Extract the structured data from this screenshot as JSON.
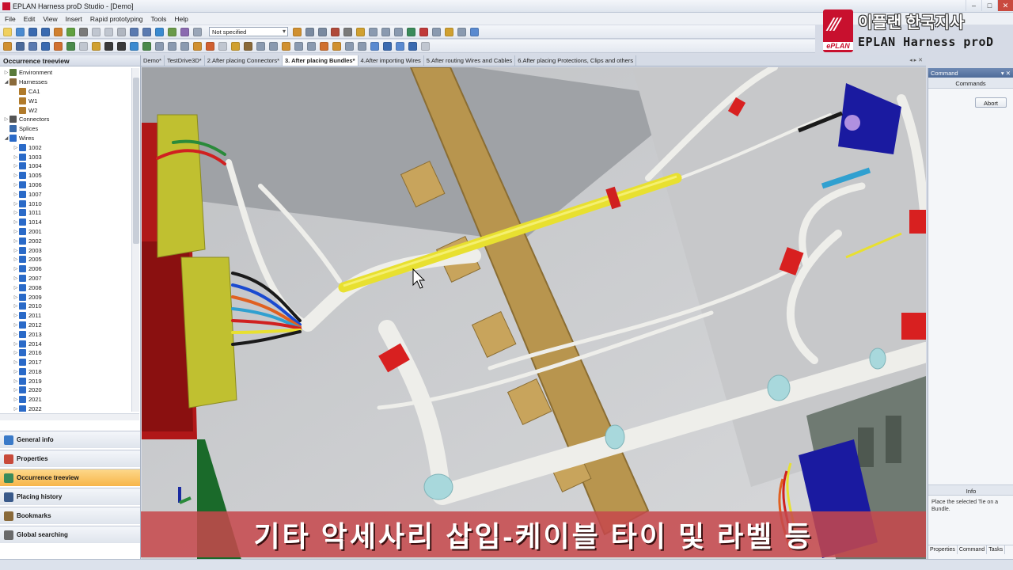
{
  "window": {
    "title": "EPLAN Harness proD Studio - [Demo]"
  },
  "menu": {
    "items": [
      "File",
      "Edit",
      "View",
      "Insert",
      "Rapid prototyping",
      "Tools",
      "Help"
    ]
  },
  "toolbar": {
    "filter_value": "Not specified"
  },
  "logo": {
    "korean_text": "이플랜 한국지사",
    "brand_text": "EPLAN Harness proD",
    "mark_text": "ePLAN"
  },
  "left_panel": {
    "title": "Occurrence treeview",
    "tree": [
      {
        "label": "Environment",
        "level": 0,
        "icon": "environment-icon",
        "color": "#5a7a3a",
        "expand": "▷"
      },
      {
        "label": "Harnesses",
        "level": 0,
        "icon": "harness-icon",
        "color": "#8a6a3a",
        "expand": "◢"
      },
      {
        "label": "CA1",
        "level": 1,
        "icon": "harness-icon",
        "color": "#b07a2a",
        "expand": ""
      },
      {
        "label": "W1",
        "level": 1,
        "icon": "harness-icon",
        "color": "#b07a2a",
        "expand": ""
      },
      {
        "label": "W2",
        "level": 1,
        "icon": "harness-icon",
        "color": "#b07a2a",
        "expand": ""
      },
      {
        "label": "Connectors",
        "level": 0,
        "icon": "connector-icon",
        "color": "#555555",
        "expand": "▷"
      },
      {
        "label": "Splices",
        "level": 0,
        "icon": "splice-icon",
        "color": "#3a6aaa",
        "expand": ""
      },
      {
        "label": "Wires",
        "level": 0,
        "icon": "wire-icon",
        "color": "#2a6ac8",
        "expand": "◢"
      },
      {
        "label": "1002",
        "level": 1,
        "icon": "wire-icon",
        "color": "#2a6ac8",
        "expand": "▷"
      },
      {
        "label": "1003",
        "level": 1,
        "icon": "wire-icon",
        "color": "#2a6ac8",
        "expand": "▷"
      },
      {
        "label": "1004",
        "level": 1,
        "icon": "wire-icon",
        "color": "#2a6ac8",
        "expand": "▷"
      },
      {
        "label": "1005",
        "level": 1,
        "icon": "wire-icon",
        "color": "#2a6ac8",
        "expand": "▷"
      },
      {
        "label": "1006",
        "level": 1,
        "icon": "wire-icon",
        "color": "#2a6ac8",
        "expand": "▷"
      },
      {
        "label": "1007",
        "level": 1,
        "icon": "wire-icon",
        "color": "#2a6ac8",
        "expand": "▷"
      },
      {
        "label": "1010",
        "level": 1,
        "icon": "wire-icon",
        "color": "#2a6ac8",
        "expand": "▷"
      },
      {
        "label": "1011",
        "level": 1,
        "icon": "wire-icon",
        "color": "#2a6ac8",
        "expand": "▷"
      },
      {
        "label": "1014",
        "level": 1,
        "icon": "wire-icon",
        "color": "#2a6ac8",
        "expand": "▷"
      },
      {
        "label": "2001",
        "level": 1,
        "icon": "wire-icon",
        "color": "#2a6ac8",
        "expand": "▷"
      },
      {
        "label": "2002",
        "level": 1,
        "icon": "wire-icon",
        "color": "#2a6ac8",
        "expand": "▷"
      },
      {
        "label": "2003",
        "level": 1,
        "icon": "wire-icon",
        "color": "#2a6ac8",
        "expand": "▷"
      },
      {
        "label": "2005",
        "level": 1,
        "icon": "wire-icon",
        "color": "#2a6ac8",
        "expand": "▷"
      },
      {
        "label": "2006",
        "level": 1,
        "icon": "wire-icon",
        "color": "#2a6ac8",
        "expand": "▷"
      },
      {
        "label": "2007",
        "level": 1,
        "icon": "wire-icon",
        "color": "#2a6ac8",
        "expand": "▷"
      },
      {
        "label": "2008",
        "level": 1,
        "icon": "wire-icon",
        "color": "#2a6ac8",
        "expand": "▷"
      },
      {
        "label": "2009",
        "level": 1,
        "icon": "wire-icon",
        "color": "#2a6ac8",
        "expand": "▷"
      },
      {
        "label": "2010",
        "level": 1,
        "icon": "wire-icon",
        "color": "#2a6ac8",
        "expand": "▷"
      },
      {
        "label": "2011",
        "level": 1,
        "icon": "wire-icon",
        "color": "#2a6ac8",
        "expand": "▷"
      },
      {
        "label": "2012",
        "level": 1,
        "icon": "wire-icon",
        "color": "#2a6ac8",
        "expand": "▷"
      },
      {
        "label": "2013",
        "level": 1,
        "icon": "wire-icon",
        "color": "#2a6ac8",
        "expand": "▷"
      },
      {
        "label": "2014",
        "level": 1,
        "icon": "wire-icon",
        "color": "#2a6ac8",
        "expand": "▷"
      },
      {
        "label": "2016",
        "level": 1,
        "icon": "wire-icon",
        "color": "#2a6ac8",
        "expand": "▷"
      },
      {
        "label": "2017",
        "level": 1,
        "icon": "wire-icon",
        "color": "#2a6ac8",
        "expand": "▷"
      },
      {
        "label": "2018",
        "level": 1,
        "icon": "wire-icon",
        "color": "#2a6ac8",
        "expand": "▷"
      },
      {
        "label": "2019",
        "level": 1,
        "icon": "wire-icon",
        "color": "#2a6ac8",
        "expand": "▷"
      },
      {
        "label": "2020",
        "level": 1,
        "icon": "wire-icon",
        "color": "#2a6ac8",
        "expand": "▷"
      },
      {
        "label": "2021",
        "level": 1,
        "icon": "wire-icon",
        "color": "#2a6ac8",
        "expand": "▷"
      },
      {
        "label": "2022",
        "level": 1,
        "icon": "wire-icon",
        "color": "#2a6ac8",
        "expand": "▷"
      }
    ],
    "nav_buttons": [
      {
        "label": "General info",
        "icon": "info-icon",
        "color": "#3a7ac8",
        "active": false
      },
      {
        "label": "Properties",
        "icon": "properties-icon",
        "color": "#c84a3a",
        "active": false
      },
      {
        "label": "Occurrence treeview",
        "icon": "treeview-icon",
        "color": "#3a8a5a",
        "active": true
      },
      {
        "label": "Placing history",
        "icon": "history-icon",
        "color": "#3a5a8a",
        "active": false
      },
      {
        "label": "Bookmarks",
        "icon": "bookmark-icon",
        "color": "#8a6a3a",
        "active": false
      },
      {
        "label": "Global searching",
        "icon": "search-icon",
        "color": "#6a6a6a",
        "active": false
      }
    ]
  },
  "tabs": [
    {
      "label": "Demo*",
      "active": false
    },
    {
      "label": "TestDrive3D*",
      "active": false
    },
    {
      "label": "2.After placing Connectors*",
      "active": false
    },
    {
      "label": "3. After placing Bundles*",
      "active": true
    },
    {
      "label": "4.After importing Wires",
      "active": false
    },
    {
      "label": "5.After routing Wires and Cables",
      "active": false
    },
    {
      "label": "6.After placing Protections, Clips and others",
      "active": false
    }
  ],
  "tab_nav": "◂ ▸ ✕",
  "right_panel": {
    "title": "Command",
    "header_controls": "▾ ✕",
    "commands_label": "Commands",
    "abort_label": "Abort",
    "info_label": "Info",
    "info_text": "Place the selected Tie on a Bundle.",
    "tabs": [
      "Properties",
      "Command",
      "Tasks"
    ]
  },
  "caption": {
    "text": "기타 악세사리 삽입-케이블 타이 및 라벨 등"
  },
  "colors": {
    "accent": "#f7b54a",
    "brand": "#c8102e",
    "bundle": "#eeeeea",
    "tape_yellow": "#e8e030",
    "bracket": "#b8954e"
  }
}
